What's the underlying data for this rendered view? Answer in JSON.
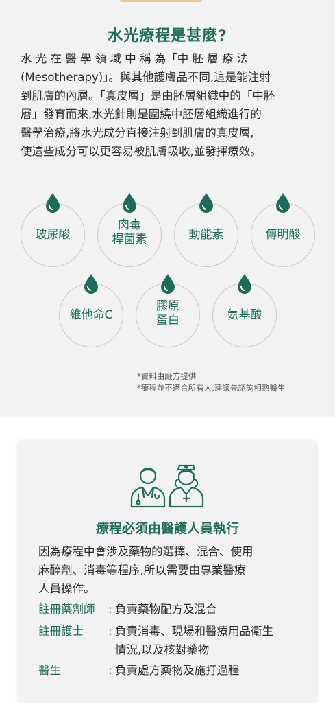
{
  "section": {
    "title": "水光療程是甚麼?",
    "intro_lines": [
      "水 光 在 醫 學 領 域 中 稱 為「中 胚 層 療 法",
      "(Mesotherapy)」。與其他護膚品不同,這是能注射",
      "到肌膚的內層。「真皮層」是由胚層組織中的「中胚",
      "層」發育而來,水光針則是圍繞中胚層組織進行的",
      "醫學治療,將水光成分直接注射到肌膚的真皮層,",
      "使這些成分可以更容易被肌膚吸收,並發揮療效。"
    ]
  },
  "ingredients": [
    {
      "lines": [
        "玻尿酸"
      ],
      "icon": "water-drop-icon"
    },
    {
      "lines": [
        "肉毒",
        "桿菌素"
      ],
      "icon": "water-drop-icon"
    },
    {
      "lines": [
        "動能素"
      ],
      "icon": "water-drop-icon"
    },
    {
      "lines": [
        "傳明酸"
      ],
      "icon": "water-drop-icon"
    },
    {
      "lines": [
        "維他命C"
      ],
      "icon": "water-drop-icon"
    },
    {
      "lines": [
        "膠原",
        "蛋白"
      ],
      "icon": "water-drop-icon"
    },
    {
      "lines": [
        "氨基酸"
      ],
      "icon": "water-drop-icon"
    }
  ],
  "notes": [
    "*資料由廠方提供",
    "*療程並不適合所有人,建議先諮詢相熟醫生"
  ],
  "card": {
    "icon": "doctor-and-nurse-icon",
    "title": "療程必須由醫護人員執行",
    "desc_lines": [
      "因為療程中會涉及藥物的選擇、混合、使用",
      "麻醉劑、消毒等程序,所以需要由專業醫療",
      "人員操作。"
    ],
    "roles": [
      {
        "name": "註冊藥劑師",
        "colon": ":",
        "desc_lines": [
          "負責藥物配方及混合"
        ]
      },
      {
        "name": "註冊護士",
        "colon": ":",
        "desc_lines": [
          "負責消毒、現場和醫療用品衛生",
          "情況,以及核對藥物"
        ]
      },
      {
        "name": "醫生",
        "colon": ":",
        "desc_lines": [
          "負責處方藥物及施打過程"
        ]
      }
    ]
  },
  "colors": {
    "accent": "#1f6b5a",
    "background": "#f2f2f2"
  }
}
